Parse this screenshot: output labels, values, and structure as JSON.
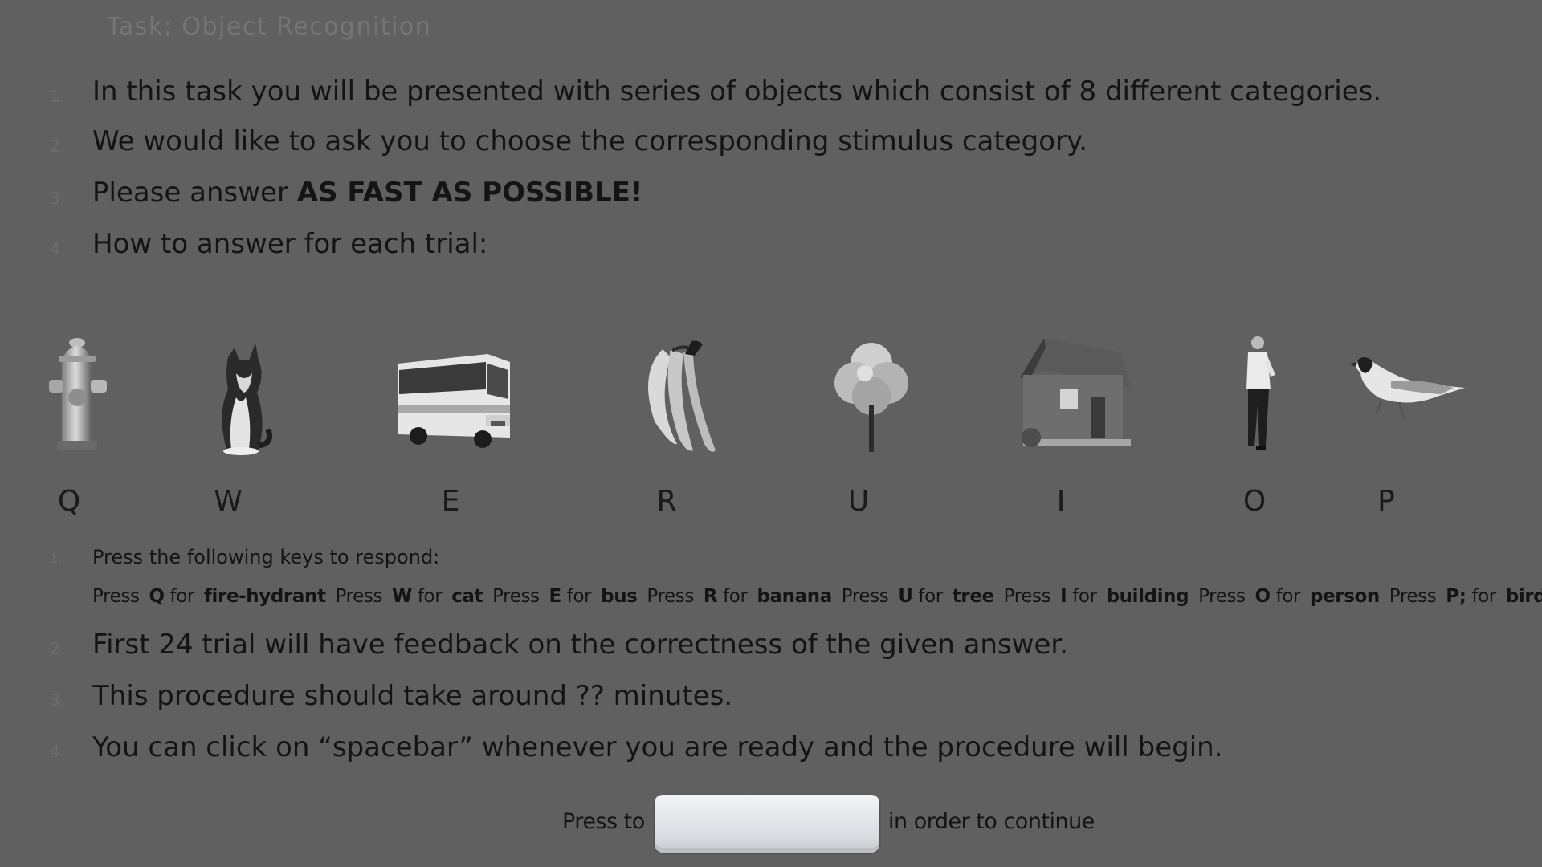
{
  "title": "Task: Object Recognition",
  "intro": [
    {
      "num": "1.",
      "text": "In this task you will be presented with series of objects which consist of 8 different categories."
    },
    {
      "num": "2.",
      "text": "We would like to ask you to choose the corresponding stimulus category."
    },
    {
      "num": "3.",
      "pre": "Please answer ",
      "bold": "AS FAST AS POSSIBLE!"
    },
    {
      "num": "4.",
      "text": "How to answer for each trial:"
    }
  ],
  "keys": [
    {
      "key": "Q",
      "category": "fire-hydrant",
      "icon": "fire-hydrant-icon"
    },
    {
      "key": "W",
      "category": "cat",
      "icon": "cat-icon"
    },
    {
      "key": "E",
      "category": "bus",
      "icon": "bus-icon"
    },
    {
      "key": "R",
      "category": "banana",
      "icon": "banana-icon"
    },
    {
      "key": "U",
      "category": "tree",
      "icon": "tree-icon"
    },
    {
      "key": "I",
      "category": "building",
      "icon": "building-icon"
    },
    {
      "key": "O",
      "category": "person",
      "icon": "person-icon"
    },
    {
      "key": "P",
      "category": "bird",
      "icon": "bird-icon"
    }
  ],
  "sub_list": {
    "num": "1.",
    "text": "Press the following keys to respond:"
  },
  "key_line": [
    {
      "press": "Press",
      "key": "Q",
      "for": "for",
      "cat": "fire-hydrant"
    },
    {
      "press": "Press",
      "key": "W",
      "for": "for",
      "cat": "cat"
    },
    {
      "press": "Press",
      "key": "E",
      "for": "for",
      "cat": "bus"
    },
    {
      "press": "Press",
      "key": "R",
      "for": "for",
      "cat": "banana"
    },
    {
      "press": "Press",
      "key": "U",
      "for": "for",
      "cat": "tree"
    },
    {
      "press": "Press",
      "key": "I",
      "for": "for",
      "cat": "building"
    },
    {
      "press": "Press",
      "key": "O",
      "for": "for",
      "cat": "person"
    },
    {
      "press": "Press",
      "key": "P;",
      "for": "for",
      "cat": "bird"
    }
  ],
  "outro": [
    {
      "num": "2.",
      "text": "First 24 trial will have feedback on the correctness of the given answer."
    },
    {
      "num": "3.",
      "text": "This procedure should take around ?? minutes."
    },
    {
      "num": "4.",
      "text": "You can click on “spacebar” whenever you are ready and the procedure will begin."
    }
  ],
  "continue": {
    "pre": "Press to",
    "post": "in order to continue",
    "key_icon": "spacebar-key-icon"
  }
}
